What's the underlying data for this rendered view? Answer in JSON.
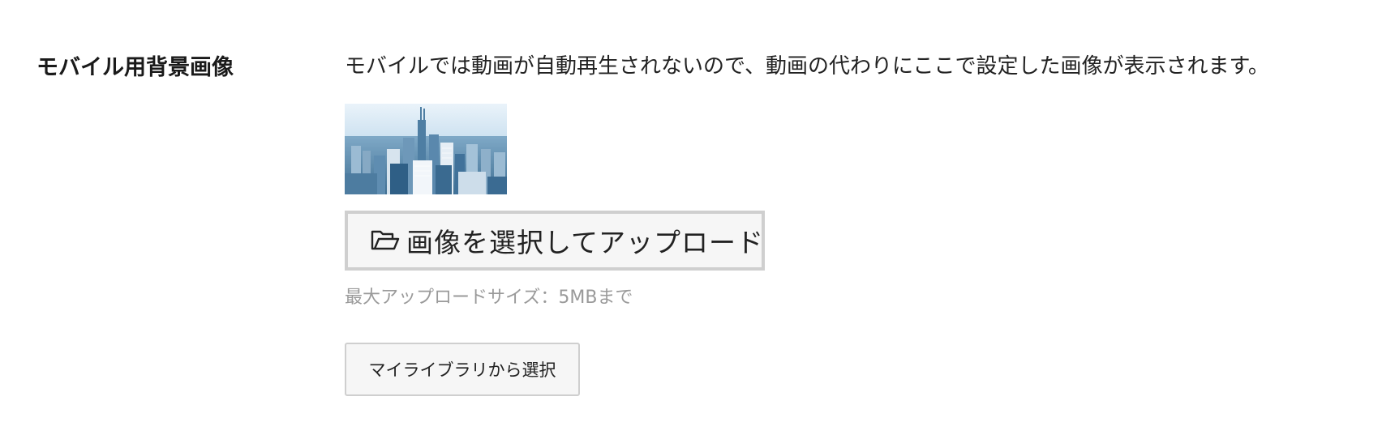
{
  "setting": {
    "label": "モバイル用背景画像",
    "description": "モバイルでは動画が自動再生されないので、動画の代わりにここで設定した画像が表示されます。"
  },
  "preview": {
    "subject": "city-skyline-photo"
  },
  "upload": {
    "icon": "folder-open-icon",
    "button_label": "画像を選択してアップロード",
    "hint": "最大アップロードサイズ：5MBまで"
  },
  "library": {
    "button_label": "マイライブラリから選択"
  },
  "colors": {
    "button_border": "#cfcfcf",
    "button_bg": "#f6f6f6",
    "hint_text": "#9a9a9a"
  }
}
